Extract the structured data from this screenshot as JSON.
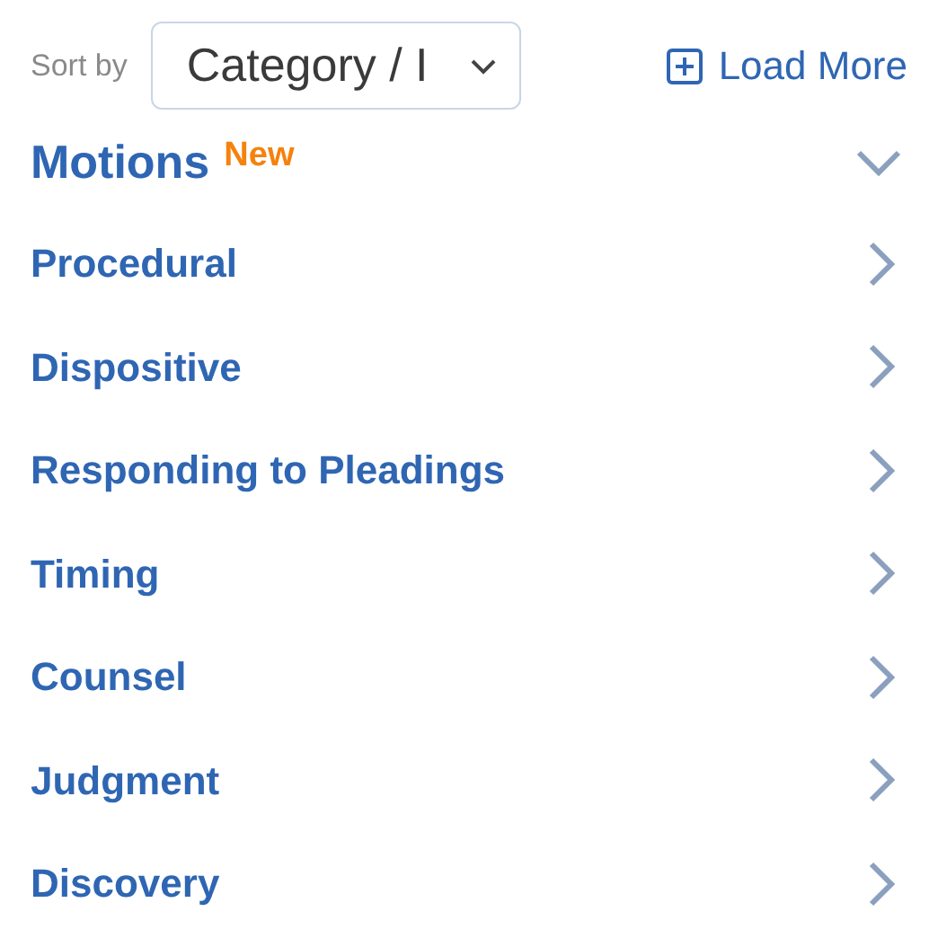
{
  "toolbar": {
    "sort_label": "Sort by",
    "sort_value": "Category / I",
    "load_more": "Load More"
  },
  "section": {
    "title": "Motions",
    "badge": "New",
    "expanded": true,
    "items": [
      {
        "label": "Procedural",
        "expanded": false
      },
      {
        "label": "Dispositive",
        "expanded": false
      },
      {
        "label": "Responding to Pleadings",
        "expanded": false
      },
      {
        "label": "Timing",
        "expanded": false
      },
      {
        "label": "Counsel",
        "expanded": false
      },
      {
        "label": "Judgment",
        "expanded": false
      },
      {
        "label": "Discovery",
        "expanded": false
      }
    ]
  }
}
